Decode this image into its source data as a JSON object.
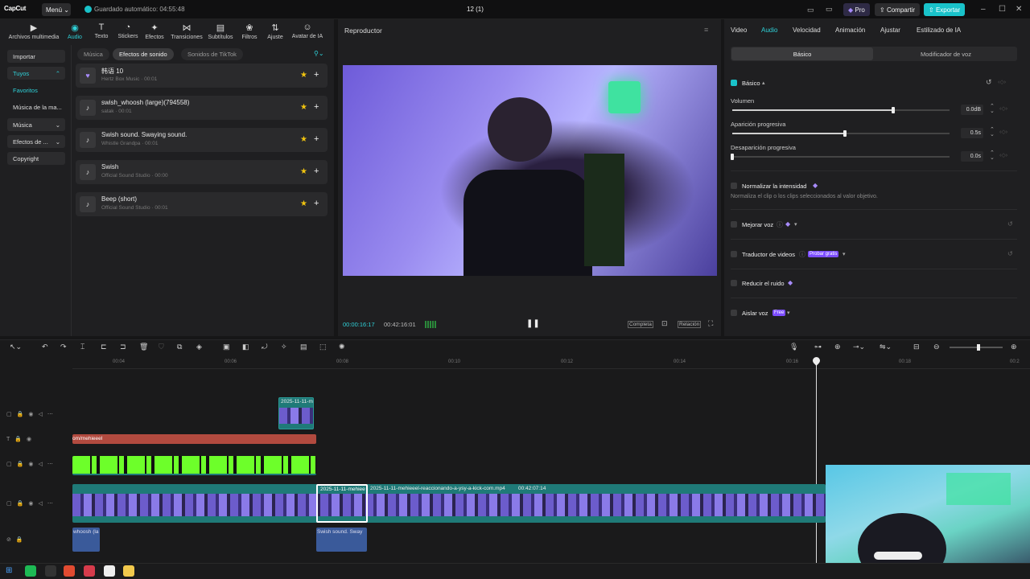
{
  "app": {
    "logo": "CapCut",
    "menu_label": "Menú",
    "autosave": "Guardado automático: 04:55:48",
    "project_title": "12 (1)",
    "pro_label": "Pro",
    "share_label": "Compartir",
    "export_label": "Exportar",
    "accent": "#2fd1d8"
  },
  "tools": [
    {
      "label": "Archivos multimedia",
      "icon": "media-icon"
    },
    {
      "label": "Audio",
      "icon": "audio-icon"
    },
    {
      "label": "Texto",
      "icon": "text-icon"
    },
    {
      "label": "Stickers",
      "icon": "sticker-icon"
    },
    {
      "label": "Efectos",
      "icon": "effects-icon"
    },
    {
      "label": "Transiciones",
      "icon": "transition-icon"
    },
    {
      "label": "Subtítulos",
      "icon": "captions-icon"
    },
    {
      "label": "Filtros",
      "icon": "filter-icon"
    },
    {
      "label": "Ajuste",
      "icon": "adjust-icon"
    },
    {
      "label": "Avatar de IA",
      "icon": "avatar-icon"
    }
  ],
  "sidebar": {
    "items": [
      {
        "label": "Importar"
      },
      {
        "label": "Tuyos"
      },
      {
        "label": "Favoritos"
      },
      {
        "label": "Música de la ma..."
      },
      {
        "label": "Música"
      },
      {
        "label": "Efectos de ..."
      },
      {
        "label": "Copyright"
      }
    ]
  },
  "sound_tabs": [
    {
      "label": "Música"
    },
    {
      "label": "Efectos de sonido"
    },
    {
      "label": "Sonidos de TikTok"
    }
  ],
  "sounds": [
    {
      "name": "韩语 10",
      "meta": "Hertz Box Music · 00:01"
    },
    {
      "name": "swish_whoosh (large)(794558)",
      "meta": "satak · 00:01"
    },
    {
      "name": "Swish sound. Swaying sound.",
      "meta": "Whistle Grandpa · 00:01"
    },
    {
      "name": "Swish",
      "meta": "Official Sound Studio · 00:00"
    },
    {
      "name": "Beep (short)",
      "meta": "Official Sound Studio · 00:01"
    }
  ],
  "player": {
    "title": "Reproductor",
    "current_time": "00:00:16:17",
    "total_time": "00:42:16:01",
    "full_label": "Completa",
    "ratio_label": "Relación"
  },
  "inspector": {
    "tabs": [
      {
        "label": "Video"
      },
      {
        "label": "Audio"
      },
      {
        "label": "Velocidad"
      },
      {
        "label": "Animación"
      },
      {
        "label": "Ajustar"
      },
      {
        "label": "Estilizado de IA"
      }
    ],
    "subtabs": [
      {
        "label": "Básico"
      },
      {
        "label": "Modificador de voz"
      }
    ],
    "basic_label": "Básico",
    "volume": {
      "label": "Volumen",
      "value": "0.0dB",
      "level": 0.74
    },
    "fade_in": {
      "label": "Aparición progresiva",
      "value": "0.5s",
      "level": 0.52
    },
    "fade_out": {
      "label": "Desaparición progresiva",
      "value": "0.0s",
      "level": 0.0
    },
    "normalize": {
      "label": "Normalizar la intensidad",
      "desc": "Normaliza el clip o los clips seleccionados al valor objetivo."
    },
    "enhance_voice": {
      "label": "Mejorar voz"
    },
    "translator": {
      "label": "Traductor de videos",
      "badge": "Probar gratis"
    },
    "reduce_noise": {
      "label": "Reducir el ruido"
    },
    "isolate_voice": {
      "label": "Aislar voz",
      "badge": "Free"
    }
  },
  "timeline": {
    "ticks": [
      "00:04",
      "00:06",
      "00:08",
      "00:10",
      "00:12",
      "00:14",
      "00:16",
      "00:18",
      "00:2"
    ],
    "top_clip_label": "2025-11-11-m",
    "text_clip_label": "om/mehieeel",
    "main_clip_label": "2025-11-11-mehieeel-reaccionando-a-ysy-a-kick-com.mp4",
    "main_clip_duration": "00:42:07:14",
    "selected_clip_label": "2025-11-11-mehiee",
    "audio_clip_1": "whoosh (la",
    "audio_clip_2": "Swish sound. Sway"
  }
}
